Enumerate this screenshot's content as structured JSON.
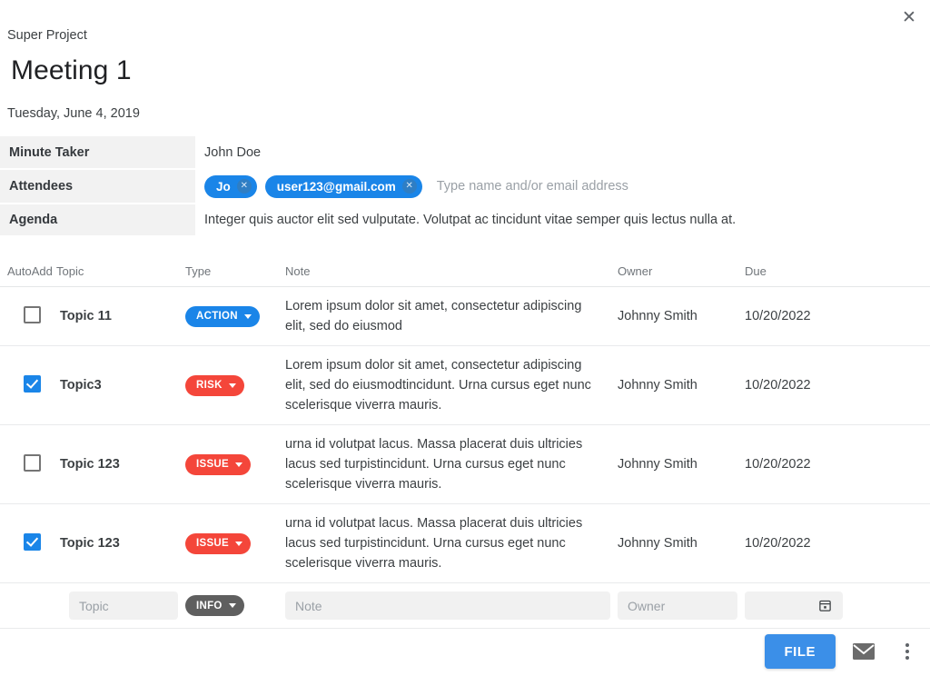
{
  "window": {
    "close_icon": "close-icon",
    "close_glyph": "✕"
  },
  "header": {
    "project": "Super Project",
    "title": "Meeting 1",
    "date": "Tuesday, June 4, 2019"
  },
  "info": {
    "minute_taker": {
      "label": "Minute Taker",
      "value": "John Doe"
    },
    "attendees": {
      "label": "Attendees",
      "chips": [
        {
          "text": "Jo",
          "remove_glyph": "✕"
        },
        {
          "text": "user123@gmail.com",
          "remove_glyph": "✕"
        }
      ],
      "input_placeholder": "Type name and/or email address",
      "input_value": ""
    },
    "agenda": {
      "label": "Agenda",
      "value": "Integer quis auctor elit sed vulputate. Volutpat ac tincidunt vitae semper quis lectus nulla at."
    }
  },
  "items": {
    "columns": [
      "AutoAdd",
      "Topic",
      "Type",
      "Note",
      "Owner",
      "Due"
    ],
    "rows": [
      {
        "autoadd": false,
        "topic": "Topic 11",
        "type": "ACTION",
        "type_color": "#1a85e8",
        "note": "Lorem ipsum dolor sit amet, consectetur adipiscing elit, sed do eiusmod",
        "owner": "Johnny Smith",
        "due": "10/20/2022"
      },
      {
        "autoadd": true,
        "topic": "Topic3",
        "type": "RISK",
        "type_color": "#f4463a",
        "note": "Lorem ipsum dolor sit amet, consectetur adipiscing elit, sed do eiusmodtincidunt. Urna cursus eget nunc scelerisque viverra mauris.",
        "owner": "Johnny Smith",
        "due": "10/20/2022"
      },
      {
        "autoadd": false,
        "topic": "Topic 123",
        "type": "ISSUE",
        "type_color": "#f4463a",
        "note": "urna id volutpat lacus. Massa placerat duis ultricies lacus sed turpistincidunt. Urna cursus eget nunc scelerisque viverra mauris.",
        "owner": "Johnny Smith",
        "due": "10/20/2022"
      },
      {
        "autoadd": true,
        "topic": "Topic 123",
        "type": "ISSUE",
        "type_color": "#f4463a",
        "note": "urna id volutpat lacus. Massa placerat duis ultricies lacus sed turpistincidunt. Urna cursus eget nunc scelerisque viverra mauris.",
        "owner": "Johnny Smith",
        "due": "10/20/2022"
      }
    ]
  },
  "new_entry": {
    "topic_placeholder": "Topic",
    "topic_value": "",
    "type": "INFO",
    "type_color": "#5f5f5f",
    "note_placeholder": "Note",
    "note_value": "",
    "owner_placeholder": "Owner",
    "owner_value": "",
    "due_value": "",
    "date_icon": "calendar-icon"
  },
  "footer": {
    "file_label": "FILE",
    "email_icon": "envelope-icon",
    "more_icon": "kebab-menu-icon"
  },
  "colors": {
    "accent_blue": "#1a85e8",
    "button_blue": "#3b8fe8",
    "danger_red": "#f4463a",
    "neutral_gray": "#5f5f5f",
    "label_bg": "#f2f2f2",
    "field_bg": "#f1f1f1"
  }
}
